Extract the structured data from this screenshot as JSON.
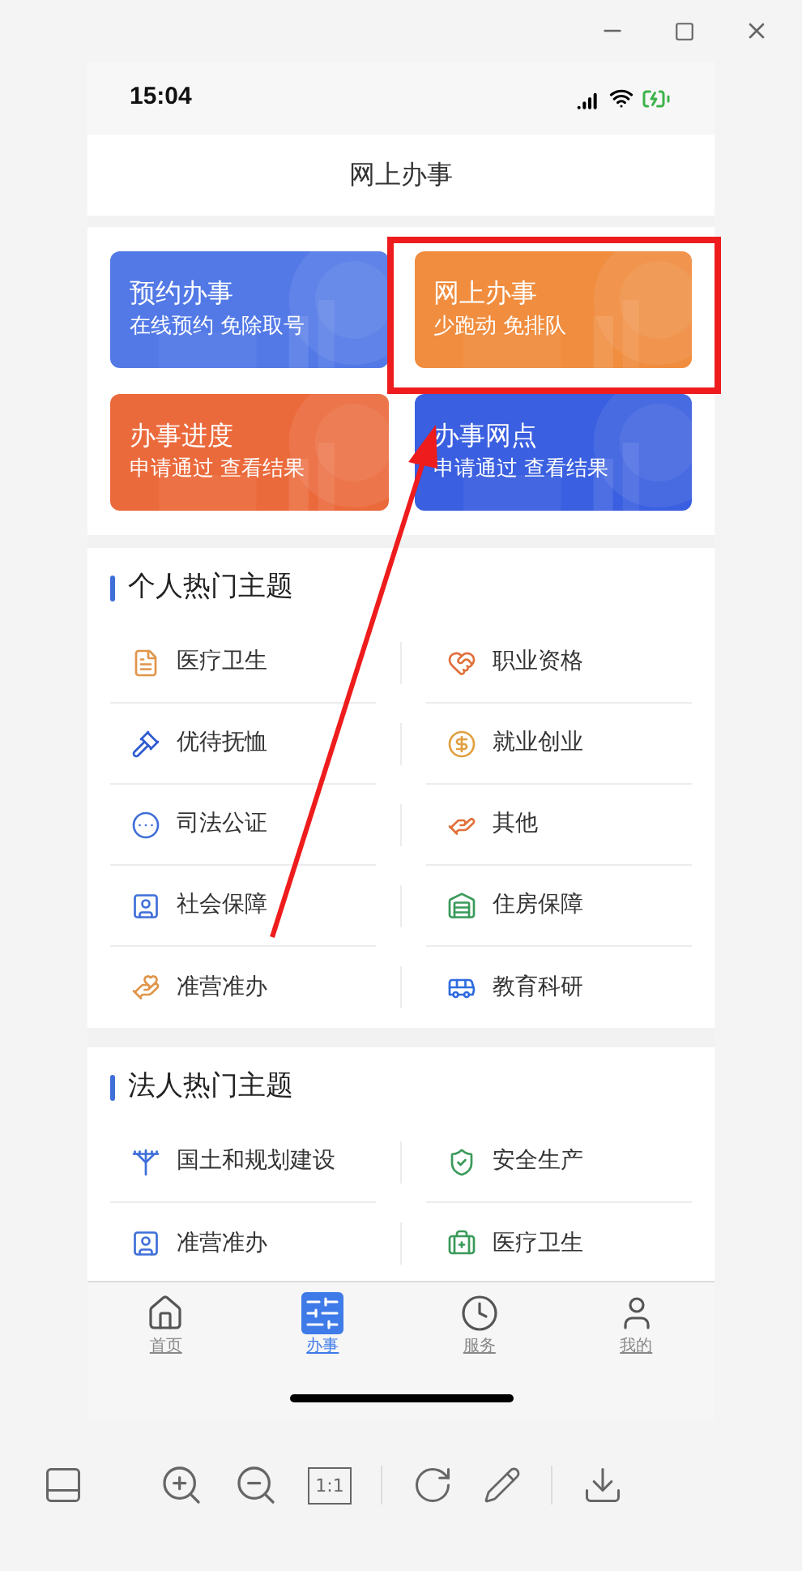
{
  "status_bar": {
    "time": "15:04"
  },
  "header": {
    "title": "网上办事"
  },
  "service_cards": [
    {
      "title": "预约办事",
      "subtitle": "在线预约 免除取号",
      "color": "#5279e6"
    },
    {
      "title": "网上办事",
      "subtitle": "少跑动 免排队",
      "color": "#f08d3f"
    },
    {
      "title": "办事进度",
      "subtitle": "申请通过 查看结果",
      "color": "#eb6a3c"
    },
    {
      "title": "办事网点",
      "subtitle": "申请通过 查看结果",
      "color": "#3a5fe0"
    }
  ],
  "sections": [
    {
      "title": "个人热门主题",
      "items": [
        {
          "label": "医疗卫生"
        },
        {
          "label": "职业资格"
        },
        {
          "label": "优待抚恤"
        },
        {
          "label": "就业创业"
        },
        {
          "label": "司法公证"
        },
        {
          "label": "其他"
        },
        {
          "label": "社会保障"
        },
        {
          "label": "住房保障"
        },
        {
          "label": "准营准办"
        },
        {
          "label": "教育科研"
        }
      ]
    },
    {
      "title": "法人热门主题",
      "items": [
        {
          "label": "国土和规划建设"
        },
        {
          "label": "安全生产"
        },
        {
          "label": "准营准办"
        },
        {
          "label": "医疗卫生"
        }
      ]
    }
  ],
  "tab_bar": [
    {
      "label": "首页",
      "selected": false
    },
    {
      "label": "办事",
      "selected": true
    },
    {
      "label": "服务",
      "selected": false
    },
    {
      "label": "我的",
      "selected": false
    }
  ],
  "toolbar": {
    "actual_size_label": "1:1"
  }
}
